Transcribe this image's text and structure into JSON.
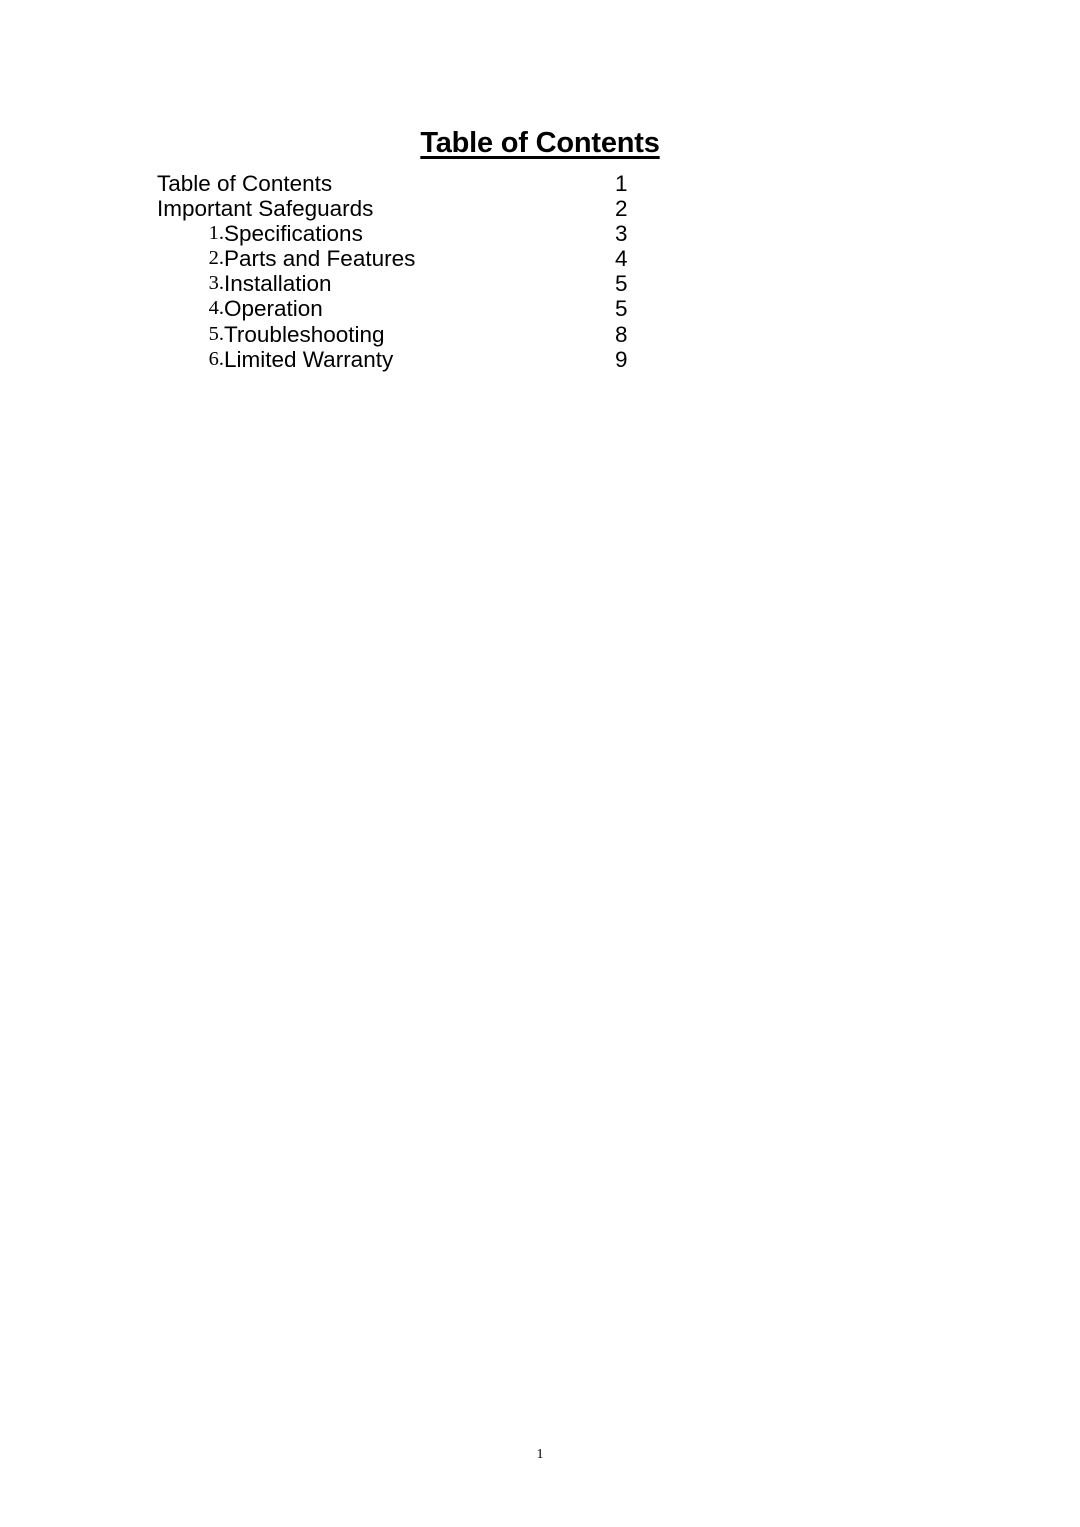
{
  "document": {
    "title": "Table of Contents",
    "footer_page_number": "1"
  },
  "toc": {
    "entries": [
      {
        "number": "",
        "title": "Table of Contents",
        "page": "1"
      },
      {
        "number": "",
        "title": "Important Safeguards",
        "page": "2"
      },
      {
        "number": "1.",
        "title": "Specifications",
        "page": "3"
      },
      {
        "number": "2.",
        "title": "Parts and Features",
        "page": "4"
      },
      {
        "number": "3.",
        "title": "Installation",
        "page": "5"
      },
      {
        "number": "4.",
        "title": "Operation",
        "page": "5"
      },
      {
        "number": "5.",
        "title": "Troubleshooting",
        "page": "8"
      },
      {
        "number": "6.",
        "title": "Limited Warranty",
        "page": "9"
      }
    ]
  }
}
